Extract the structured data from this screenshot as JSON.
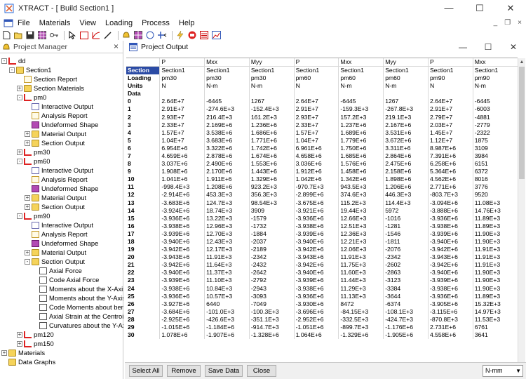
{
  "app": {
    "title": "XTRACT - [ Build Section1 ]",
    "window_buttons": [
      "—",
      "☐",
      "✕"
    ]
  },
  "menu": {
    "items": [
      "File",
      "Materials",
      "View",
      "Loading",
      "Process",
      "Help"
    ],
    "mdi_buttons": [
      "_",
      "❐",
      "×"
    ]
  },
  "toolbar": {
    "icons": [
      "new-icon",
      "open-icon",
      "save-icon",
      "material-icon",
      "key-icon",
      "select-icon",
      "rectangle-icon",
      "arc-icon",
      "pen-icon",
      "bell-icon",
      "grid-icon",
      "section-icon",
      "cross-icon",
      "lightning-icon",
      "run-icon",
      "report-icon",
      "chart-icon"
    ]
  },
  "project_manager": {
    "title": "Project Manager",
    "close": "×",
    "tree": [
      {
        "label": "dd",
        "level": 0,
        "expand": "-",
        "icon": "frame"
      },
      {
        "label": "Section1",
        "level": 1,
        "expand": "-",
        "icon": "folder"
      },
      {
        "label": "Section Report",
        "level": 2,
        "expand": "",
        "icon": "note"
      },
      {
        "label": "Section Materials",
        "level": 2,
        "expand": "+",
        "icon": "folder"
      },
      {
        "label": "pm0",
        "level": 2,
        "expand": "-",
        "icon": "frame"
      },
      {
        "label": "Interactive Output",
        "level": 3,
        "expand": "",
        "icon": "doc"
      },
      {
        "label": "Analysis Report",
        "level": 3,
        "expand": "",
        "icon": "note"
      },
      {
        "label": "Undeformed Shape",
        "level": 3,
        "expand": "",
        "icon": "grid"
      },
      {
        "label": "Material Output",
        "level": 3,
        "expand": "+",
        "icon": "folder"
      },
      {
        "label": "Section Output",
        "level": 3,
        "expand": "+",
        "icon": "folder"
      },
      {
        "label": "pm30",
        "level": 2,
        "expand": "+",
        "icon": "frame"
      },
      {
        "label": "pm60",
        "level": 2,
        "expand": "-",
        "icon": "frame"
      },
      {
        "label": "Interactive Output",
        "level": 3,
        "expand": "",
        "icon": "doc"
      },
      {
        "label": "Analysis Report",
        "level": 3,
        "expand": "",
        "icon": "note"
      },
      {
        "label": "Undeformed Shape",
        "level": 3,
        "expand": "",
        "icon": "grid"
      },
      {
        "label": "Material Output",
        "level": 3,
        "expand": "+",
        "icon": "folder"
      },
      {
        "label": "Section Output",
        "level": 3,
        "expand": "+",
        "icon": "folder"
      },
      {
        "label": "pm90",
        "level": 2,
        "expand": "-",
        "icon": "frame"
      },
      {
        "label": "Interactive Output",
        "level": 3,
        "expand": "",
        "icon": "doc"
      },
      {
        "label": "Analysis Report",
        "level": 3,
        "expand": "",
        "icon": "note"
      },
      {
        "label": "Undeformed Shape",
        "level": 3,
        "expand": "",
        "icon": "grid"
      },
      {
        "label": "Material Output",
        "level": 3,
        "expand": "+",
        "icon": "folder"
      },
      {
        "label": "Section Output",
        "level": 3,
        "expand": "-",
        "icon": "folder"
      },
      {
        "label": "Axial Force",
        "level": 4,
        "expand": "",
        "icon": "plot"
      },
      {
        "label": "Code Axial Force",
        "level": 4,
        "expand": "",
        "icon": "plot"
      },
      {
        "label": "Moments about the X-Axis",
        "level": 4,
        "expand": "",
        "icon": "plot"
      },
      {
        "label": "Moments about the Y-Axis",
        "level": 4,
        "expand": "",
        "icon": "plot"
      },
      {
        "label": "Code Moments about bending",
        "level": 4,
        "expand": "",
        "icon": "plot"
      },
      {
        "label": "Axial Strain at the Centroid",
        "level": 4,
        "expand": "",
        "icon": "plot"
      },
      {
        "label": "Curvatures about the Y-Axis",
        "level": 4,
        "expand": "",
        "icon": "plot"
      },
      {
        "label": "pm120",
        "level": 2,
        "expand": "+",
        "icon": "frame"
      },
      {
        "label": "pm150",
        "level": 2,
        "expand": "+",
        "icon": "frame"
      },
      {
        "label": "Materials",
        "level": 0,
        "expand": "+",
        "icon": "folder"
      },
      {
        "label": "Data Graphs",
        "level": 0,
        "expand": "",
        "icon": "folder"
      }
    ]
  },
  "output": {
    "title": "Project Output",
    "window_buttons": [
      "—",
      "☐",
      "✕"
    ],
    "header_row": [
      "",
      "P",
      "Mxx",
      "Myy",
      "P",
      "Mxx",
      "Myy",
      "P",
      "Mxx"
    ],
    "meta_rows": [
      [
        "Section",
        "Section1",
        "Section1",
        "Section1",
        "Section1",
        "Section1",
        "Section1",
        "Section1",
        "Section1"
      ],
      [
        "Loading",
        "pm30",
        "pm30",
        "pm30",
        "pm60",
        "pm60",
        "pm60",
        "pm90",
        "pm90"
      ],
      [
        "Units",
        "N",
        "N-m",
        "N-m",
        "N",
        "N-m",
        "N-m",
        "N",
        "N-m"
      ],
      [
        "Data",
        "",
        "",
        "",
        "",
        "",
        "",
        "",
        ""
      ]
    ],
    "data_rows": [
      [
        "0",
        "2.64E+7",
        "-6445",
        "1267",
        "2.64E+7",
        "-6445",
        "1267",
        "2.64E+7",
        "-6445"
      ],
      [
        "1",
        "2.91E+7",
        "-274.6E+3",
        "-152.4E+3",
        "2.91E+7",
        "-159.3E+3",
        "-267.8E+3",
        "2.91E+7",
        "-6003"
      ],
      [
        "2",
        "2.93E+7",
        "216.4E+3",
        "161.2E+3",
        "2.93E+7",
        "157.2E+3",
        "219.1E+3",
        "2.79E+7",
        "-4881"
      ],
      [
        "3",
        "2.33E+7",
        "2.169E+6",
        "1.236E+6",
        "2.33E+7",
        "1.237E+6",
        "2.167E+6",
        "2.03E+7",
        "-2779"
      ],
      [
        "4",
        "1.57E+7",
        "3.538E+6",
        "1.686E+6",
        "1.57E+7",
        "1.689E+6",
        "3.531E+6",
        "1.45E+7",
        "-2322"
      ],
      [
        "5",
        "1.04E+7",
        "3.683E+6",
        "1.771E+6",
        "1.04E+7",
        "1.779E+6",
        "3.672E+6",
        "1.12E+7",
        "1875"
      ],
      [
        "6",
        "6.954E+6",
        "3.322E+6",
        "1.742E+6",
        "6.961E+6",
        "1.750E+6",
        "3.311E+6",
        "8.987E+6",
        "3109"
      ],
      [
        "7",
        "4.659E+6",
        "2.878E+6",
        "1.674E+6",
        "4.658E+6",
        "1.685E+6",
        "2.864E+6",
        "7.391E+6",
        "3984"
      ],
      [
        "8",
        "3.037E+6",
        "2.490E+6",
        "1.553E+6",
        "3.036E+6",
        "1.576E+6",
        "2.475E+6",
        "6.258E+6",
        "6151"
      ],
      [
        "9",
        "1.908E+6",
        "2.170E+6",
        "1.443E+6",
        "1.912E+6",
        "1.458E+6",
        "2.158E+6",
        "5.364E+6",
        "6372"
      ],
      [
        "10",
        "1.041E+6",
        "1.911E+6",
        "1.329E+6",
        "1.042E+6",
        "1.342E+6",
        "1.898E+6",
        "4.562E+6",
        "8016"
      ],
      [
        "11",
        "-998.4E+3",
        "1.208E+6",
        "923.2E+3",
        "-970.7E+3",
        "943.5E+3",
        "1.206E+6",
        "2.771E+6",
        "3776"
      ],
      [
        "12",
        "-2.914E+6",
        "453.3E+3",
        "356.3E+3",
        "-2.899E+6",
        "374.6E+3",
        "446.3E+3",
        "-803.7E+3",
        "9520"
      ],
      [
        "13",
        "-3.683E+6",
        "124.7E+3",
        "98.54E+3",
        "-3.675E+6",
        "115.2E+3",
        "114.4E+3",
        "-3.094E+6",
        "11.08E+3"
      ],
      [
        "14",
        "-3.924E+6",
        "18.74E+3",
        "3909",
        "-3.921E+6",
        "19.44E+3",
        "5972",
        "-3.888E+6",
        "14.76E+3"
      ],
      [
        "15",
        "-3.936E+6",
        "13.22E+3",
        "-1579",
        "-3.936E+6",
        "12.66E+3",
        "-1016",
        "-3.936E+6",
        "11.89E+3"
      ],
      [
        "16",
        "-3.938E+6",
        "12.96E+3",
        "-1732",
        "-3.938E+6",
        "12.51E+3",
        "-1281",
        "-3.938E+6",
        "11.89E+3"
      ],
      [
        "17",
        "-3.939E+6",
        "12.70E+3",
        "-1884",
        "-3.939E+6",
        "12.36E+3",
        "-1546",
        "-3.939E+6",
        "11.90E+3"
      ],
      [
        "18",
        "-3.940E+6",
        "12.43E+3",
        "-2037",
        "-3.940E+6",
        "12.21E+3",
        "-1811",
        "-3.940E+6",
        "11.90E+3"
      ],
      [
        "19",
        "-3.942E+6",
        "12.17E+3",
        "-2189",
        "-3.942E+6",
        "12.06E+3",
        "-2076",
        "-3.942E+6",
        "11.91E+3"
      ],
      [
        "20",
        "-3.943E+6",
        "11.91E+3",
        "-2342",
        "-3.943E+6",
        "11.91E+3",
        "-2342",
        "-3.943E+6",
        "11.91E+3"
      ],
      [
        "21",
        "-3.942E+6",
        "11.64E+3",
        "-2432",
        "-3.942E+6",
        "11.75E+3",
        "-2602",
        "-3.942E+6",
        "11.91E+3"
      ],
      [
        "22",
        "-3.940E+6",
        "11.37E+3",
        "-2642",
        "-3.940E+6",
        "11.60E+3",
        "-2863",
        "-3.940E+6",
        "11.90E+3"
      ],
      [
        "23",
        "-3.939E+6",
        "11.10E+3",
        "-2792",
        "-3.939E+6",
        "11.44E+3",
        "-3123",
        "-3.939E+6",
        "11.90E+3"
      ],
      [
        "24",
        "-3.938E+6",
        "10.84E+3",
        "-2943",
        "-3.938E+6",
        "11.29E+3",
        "-3384",
        "-3.938E+6",
        "11.90E+3"
      ],
      [
        "25",
        "-3.936E+6",
        "10.57E+3",
        "-3093",
        "-3.936E+6",
        "11.13E+3",
        "-3644",
        "-3.936E+6",
        "11.89E+3"
      ],
      [
        "26",
        "-3.927E+6",
        "6440",
        "-7049",
        "-3.930E+6",
        "8472",
        "-6374",
        "-3.905E+6",
        "15.32E+3"
      ],
      [
        "27",
        "-3.684E+6",
        "-101.0E+3",
        "-100.3E+3",
        "-3.696E+6",
        "-84.15E+3",
        "-108.1E+3",
        "-3.115E+6",
        "14.97E+3"
      ],
      [
        "28",
        "-2.925E+6",
        "-426.6E+3",
        "-351.1E+3",
        "-2.952E+6",
        "-332.5E+3",
        "-424.7E+3",
        "-870.8E+3",
        "11.53E+3"
      ],
      [
        "29",
        "-1.015E+6",
        "-1.184E+6",
        "-914.7E+3",
        "-1.051E+6",
        "-899.7E+3",
        "-1.176E+6",
        "2.731E+6",
        "6761"
      ],
      [
        "30",
        "1.078E+6",
        "-1.907E+6",
        "-1.328E+6",
        "1.064E+6",
        "-1.329E+6",
        "-1.905E+6",
        "4.558E+6",
        "3641"
      ]
    ],
    "buttons": [
      "Select All",
      "Remove",
      "Save Data",
      "Close"
    ],
    "units_select": "N-mm"
  }
}
